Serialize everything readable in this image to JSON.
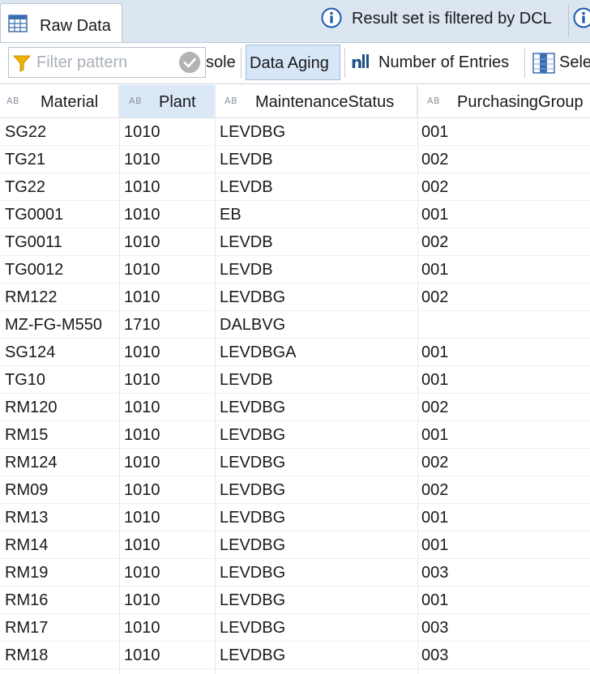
{
  "tab": {
    "label": "Raw Data",
    "icon": "table-icon"
  },
  "banner": {
    "message": "Result set is filtered by DCL",
    "icon": "info-icon"
  },
  "toolbar": {
    "filter_placeholder": "Filter pattern",
    "console_label": "sole",
    "data_aging_label": "Data Aging",
    "entries_label": "Number of Entries",
    "select_label": "Sele"
  },
  "columns": [
    {
      "type_badge": "AB",
      "label": "Material"
    },
    {
      "type_badge": "AB",
      "label": "Plant"
    },
    {
      "type_badge": "AB",
      "label": "MaintenanceStatus"
    },
    {
      "type_badge": "AB",
      "label": "PurchasingGroup"
    }
  ],
  "rows": [
    [
      "SG22",
      "1010",
      "LEVDBG",
      "001"
    ],
    [
      "TG21",
      "1010",
      "LEVDB",
      "002"
    ],
    [
      "TG22",
      "1010",
      "LEVDB",
      "002"
    ],
    [
      "TG0001",
      "1010",
      "EB",
      "001"
    ],
    [
      "TG0011",
      "1010",
      "LEVDB",
      "002"
    ],
    [
      "TG0012",
      "1010",
      "LEVDB",
      "001"
    ],
    [
      "RM122",
      "1010",
      "LEVDBG",
      "002"
    ],
    [
      "MZ-FG-M550",
      "1710",
      "DALBVG",
      ""
    ],
    [
      "SG124",
      "1010",
      "LEVDBGA",
      "001"
    ],
    [
      "TG10",
      "1010",
      "LEVDB",
      "001"
    ],
    [
      "RM120",
      "1010",
      "LEVDBG",
      "002"
    ],
    [
      "RM15",
      "1010",
      "LEVDBG",
      "001"
    ],
    [
      "RM124",
      "1010",
      "LEVDBG",
      "002"
    ],
    [
      "RM09",
      "1010",
      "LEVDBG",
      "002"
    ],
    [
      "RM13",
      "1010",
      "LEVDBG",
      "001"
    ],
    [
      "RM14",
      "1010",
      "LEVDBG",
      "001"
    ],
    [
      "RM19",
      "1010",
      "LEVDBG",
      "003"
    ],
    [
      "RM16",
      "1010",
      "LEVDBG",
      "001"
    ],
    [
      "RM17",
      "1010",
      "LEVDBG",
      "003"
    ],
    [
      "RM18",
      "1010",
      "LEVDBG",
      "003"
    ]
  ],
  "colors": {
    "info_blue": "#1e5aa8",
    "tabbar_bg": "#dce6f1",
    "header_sorted_bg": "#dbe8f6",
    "filter_yellow": "#f2b300"
  }
}
